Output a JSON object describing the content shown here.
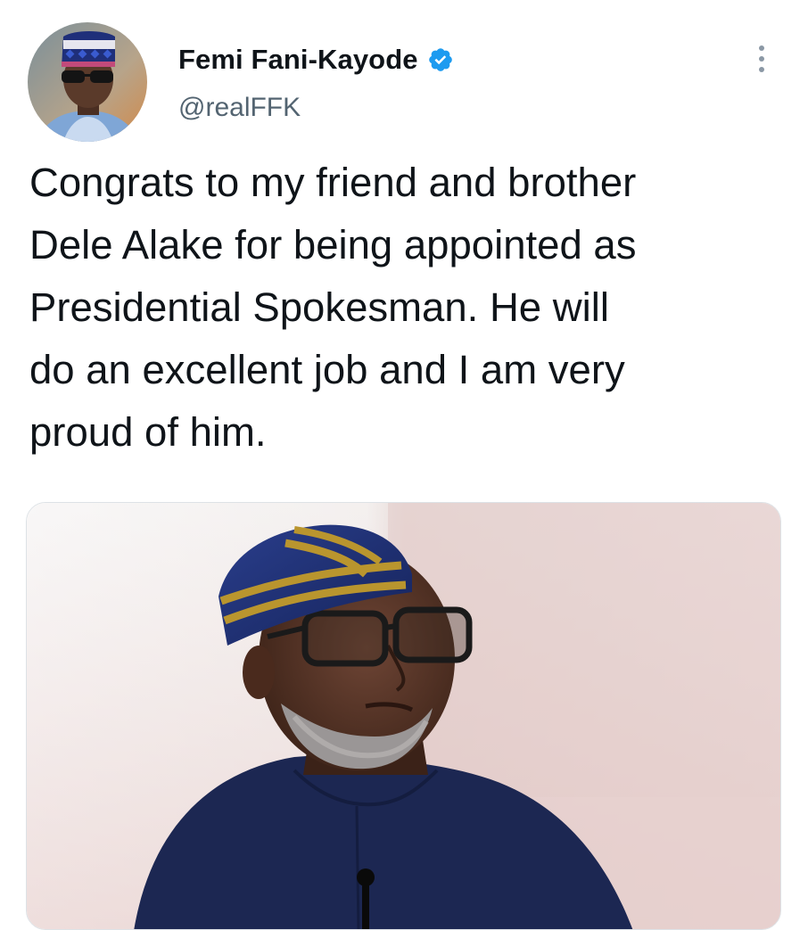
{
  "tweet": {
    "author": {
      "display_name": "Femi Fani-Kayode",
      "handle": "@realFFK",
      "verified": true,
      "avatar_icon": "profile-photo"
    },
    "text": "Congrats to my friend and brother\nDele Alake for being appointed as\nPresidential Spokesman. He will\ndo an excellent job and I am very\nproud of him.",
    "more_icon": "more-vertical-icon",
    "media": {
      "type": "photo"
    }
  },
  "colors": {
    "text_primary": "#0f1419",
    "text_secondary": "#536471",
    "verified_blue": "#1d9bf0"
  }
}
